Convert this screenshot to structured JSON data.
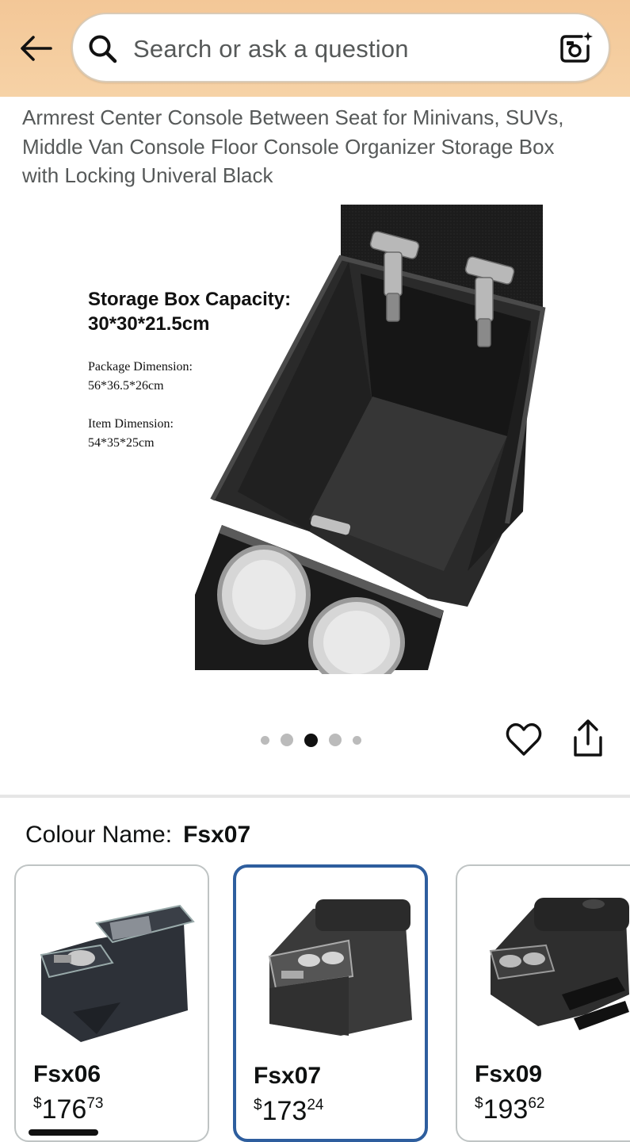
{
  "header": {
    "search_placeholder": "Search or ask a question"
  },
  "product": {
    "title": "Armrest Center Console Between Seat for Minivans, SUVs, Middle Van Console Floor Console Organizer Storage Box with Locking Univeral Black",
    "image_text": {
      "capacity_heading": "Storage Box Capacity:",
      "capacity_value": "30*30*21.5cm",
      "package_label": "Package Dimension:",
      "package_value": "56*36.5*26cm",
      "item_label": "Item Dimension:",
      "item_value": "54*35*25cm"
    },
    "gallery": {
      "total": 5,
      "active_index": 2
    }
  },
  "colour": {
    "label": "Colour Name:",
    "selected": "Fsx07",
    "options": [
      {
        "name": "Fsx06",
        "currency": "$",
        "whole": "176",
        "fraction": "73"
      },
      {
        "name": "Fsx07",
        "currency": "$",
        "whole": "173",
        "fraction": "24"
      },
      {
        "name": "Fsx09",
        "currency": "$",
        "whole": "193",
        "fraction": "62"
      }
    ]
  }
}
